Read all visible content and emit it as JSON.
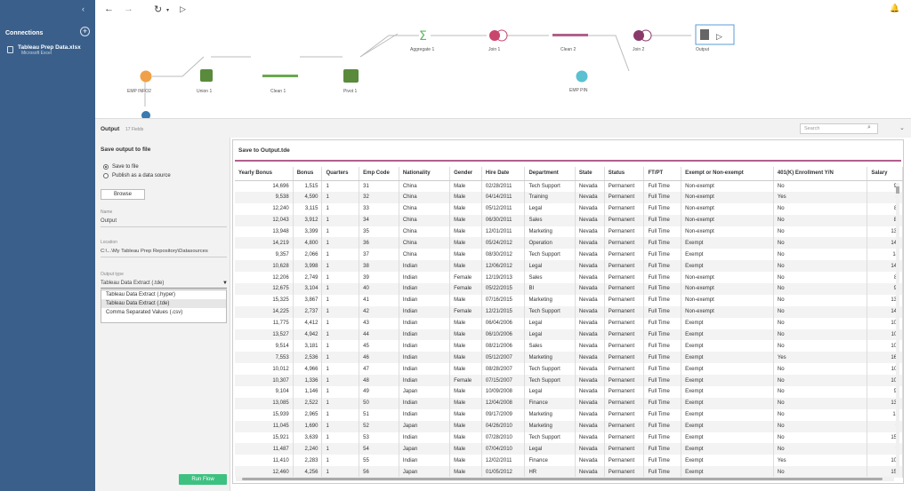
{
  "sidebar": {
    "collapse": "‹",
    "connections_title": "Connections",
    "add": "+",
    "file_name": "Tableau Prep Data.xlsx",
    "file_type": "Microsoft Excel"
  },
  "toolbar": {
    "back": "←",
    "forward": "→",
    "refresh": "↻",
    "refresh_caret": "▾",
    "run": "▷",
    "alert": "🔔"
  },
  "flow": {
    "nodes": [
      {
        "label": "EMP INFO2",
        "color": "#f0a048"
      },
      {
        "label": "Union 1",
        "color": "#5a8a3c"
      },
      {
        "label": "Clean 1",
        "color": "#6aa84f"
      },
      {
        "label": "Pivot 1",
        "color": "#5a8a3c"
      },
      {
        "label": "Aggregate 1",
        "color": "#5cb85c"
      },
      {
        "label": "Join 1",
        "color": "#c9466d"
      },
      {
        "label": "Clean 2",
        "color": "#b0608d"
      },
      {
        "label": "EMP PIN",
        "color": "#5bc0d0"
      },
      {
        "label": "Join 2",
        "color": "#8a3a6a"
      },
      {
        "label": "Output",
        "color": "#666666"
      }
    ]
  },
  "output_header": {
    "title": "Output",
    "fields": "17 Fields",
    "search_placeholder": "Search",
    "search_icon": "⌕",
    "collapse": "⌄"
  },
  "settings": {
    "heading": "Save output to file",
    "options": [
      "Save to file",
      "Publish as a data source"
    ],
    "browse": "Browse",
    "name_label": "Name",
    "name_value": "Output",
    "location_label": "Location",
    "location_value": "C:\\...\\My Tableau Prep Repository\\Datasources",
    "type_label": "Output type",
    "type_value": "Tableau Data Extract (.tde)",
    "type_options": [
      "Tableau Data Extract (.hyper)",
      "Tableau Data Extract (.tde)",
      "Comma Separated Values (.csv)"
    ],
    "run": "Run Flow"
  },
  "grid": {
    "title": "Save to Output.tde",
    "columns": [
      "Yearly Bonus",
      "Bonus",
      "Quarters",
      "Emp Code",
      "Nationality",
      "Gender",
      "Hire Date",
      "Department",
      "State",
      "Status",
      "FT/PT",
      "Exempt or Non-exempt",
      "401(K) Enrollment Y/N",
      "Salary"
    ],
    "rows": [
      [
        "14,696",
        "1,515",
        "1",
        "31",
        "China",
        "Male",
        "02/28/2011",
        "Tech Support",
        "Nevada",
        "Permanent",
        "Full Time",
        "Non-exempt",
        "No",
        "9("
      ],
      [
        "9,538",
        "4,590",
        "1",
        "32",
        "China",
        "Male",
        "04/14/2011",
        "Training",
        "Nevada",
        "Permanent",
        "Full Time",
        "Non-exempt",
        "Yes",
        "8"
      ],
      [
        "12,240",
        "3,115",
        "1",
        "33",
        "China",
        "Male",
        "05/12/2011",
        "Legal",
        "Nevada",
        "Permanent",
        "Full Time",
        "Non-exempt",
        "No",
        "8!"
      ],
      [
        "12,043",
        "3,912",
        "1",
        "34",
        "China",
        "Male",
        "06/30/2011",
        "Sales",
        "Nevada",
        "Permanent",
        "Full Time",
        "Non-exempt",
        "No",
        "8("
      ],
      [
        "13,948",
        "3,399",
        "1",
        "35",
        "China",
        "Male",
        "12/01/2011",
        "Marketing",
        "Nevada",
        "Permanent",
        "Full Time",
        "Non-exempt",
        "No",
        "13("
      ],
      [
        "14,219",
        "4,800",
        "1",
        "36",
        "China",
        "Male",
        "05/24/2012",
        "Operation",
        "Nevada",
        "Permanent",
        "Full Time",
        "Exempt",
        "No",
        "14("
      ],
      [
        "9,357",
        "2,066",
        "1",
        "37",
        "China",
        "Male",
        "08/30/2012",
        "Tech Support",
        "Nevada",
        "Permanent",
        "Full Time",
        "Exempt",
        "No",
        "14"
      ],
      [
        "10,628",
        "3,998",
        "1",
        "38",
        "Indian",
        "Male",
        "12/06/2012",
        "Legal",
        "Nevada",
        "Permanent",
        "Full Time",
        "Exempt",
        "No",
        "14("
      ],
      [
        "12,206",
        "2,749",
        "1",
        "39",
        "Indian",
        "Female",
        "12/19/2013",
        "Sales",
        "Nevada",
        "Permanent",
        "Full Time",
        "Non-exempt",
        "No",
        "8!"
      ],
      [
        "12,675",
        "3,104",
        "1",
        "40",
        "Indian",
        "Female",
        "05/22/2015",
        "BI",
        "Nevada",
        "Permanent",
        "Full Time",
        "Non-exempt",
        "No",
        "9("
      ],
      [
        "15,325",
        "3,867",
        "1",
        "41",
        "Indian",
        "Male",
        "07/16/2015",
        "Marketing",
        "Nevada",
        "Permanent",
        "Full Time",
        "Non-exempt",
        "No",
        "13("
      ],
      [
        "14,225",
        "2,737",
        "1",
        "42",
        "Indian",
        "Female",
        "12/21/2015",
        "Tech Support",
        "Nevada",
        "Permanent",
        "Full Time",
        "Non-exempt",
        "No",
        "14("
      ],
      [
        "11,775",
        "4,412",
        "1",
        "43",
        "Indian",
        "Male",
        "06/04/2006",
        "Legal",
        "Nevada",
        "Permanent",
        "Full Time",
        "Exempt",
        "No",
        "10("
      ],
      [
        "13,527",
        "4,942",
        "1",
        "44",
        "Indian",
        "Male",
        "06/10/2006",
        "Legal",
        "Nevada",
        "Permanent",
        "Full Time",
        "Exempt",
        "No",
        "10!"
      ],
      [
        "9,514",
        "3,181",
        "1",
        "45",
        "Indian",
        "Male",
        "08/21/2006",
        "Sales",
        "Nevada",
        "Permanent",
        "Full Time",
        "Exempt",
        "No",
        "10("
      ],
      [
        "7,553",
        "2,536",
        "1",
        "46",
        "Indian",
        "Male",
        "05/12/2007",
        "Marketing",
        "Nevada",
        "Permanent",
        "Full Time",
        "Exempt",
        "Yes",
        "16("
      ],
      [
        "10,012",
        "4,966",
        "1",
        "47",
        "Indian",
        "Male",
        "08/28/2007",
        "Tech Support",
        "Nevada",
        "Permanent",
        "Full Time",
        "Exempt",
        "No",
        "10!"
      ],
      [
        "10,307",
        "1,336",
        "1",
        "48",
        "Indian",
        "Female",
        "07/15/2007",
        "Tech Support",
        "Nevada",
        "Permanent",
        "Full Time",
        "Exempt",
        "No",
        "10("
      ],
      [
        "9,104",
        "1,146",
        "1",
        "49",
        "Japan",
        "Male",
        "10/09/2008",
        "Legal",
        "Nevada",
        "Permanent",
        "Full Time",
        "Exempt",
        "No",
        "9("
      ],
      [
        "13,085",
        "2,522",
        "1",
        "50",
        "Indian",
        "Male",
        "12/04/2008",
        "Finance",
        "Nevada",
        "Permanent",
        "Full Time",
        "Exempt",
        "No",
        "13("
      ],
      [
        "15,939",
        "2,965",
        "1",
        "51",
        "Indian",
        "Male",
        "09/17/2009",
        "Marketing",
        "Nevada",
        "Permanent",
        "Full Time",
        "Exempt",
        "No",
        "12"
      ],
      [
        "11,045",
        "1,690",
        "1",
        "52",
        "Japan",
        "Male",
        "04/26/2010",
        "Marketing",
        "Nevada",
        "Permanent",
        "Full Time",
        "Exempt",
        "No",
        "9"
      ],
      [
        "15,921",
        "3,639",
        "1",
        "53",
        "Indian",
        "Male",
        "07/28/2010",
        "Tech Support",
        "Nevada",
        "Permanent",
        "Full Time",
        "Exempt",
        "No",
        "15("
      ],
      [
        "11,487",
        "2,240",
        "1",
        "54",
        "Japan",
        "Male",
        "07/04/2010",
        "Legal",
        "Nevada",
        "Permanent",
        "Full Time",
        "Exempt",
        "No",
        "9"
      ],
      [
        "11,410",
        "2,283",
        "1",
        "55",
        "Indian",
        "Male",
        "12/02/2011",
        "Finance",
        "Nevada",
        "Permanent",
        "Full Time",
        "Exempt",
        "Yes",
        "10("
      ],
      [
        "12,460",
        "4,256",
        "1",
        "56",
        "Japan",
        "Male",
        "01/05/2012",
        "HR",
        "Nevada",
        "Permanent",
        "Full Time",
        "Exempt",
        "No",
        "15("
      ]
    ]
  }
}
